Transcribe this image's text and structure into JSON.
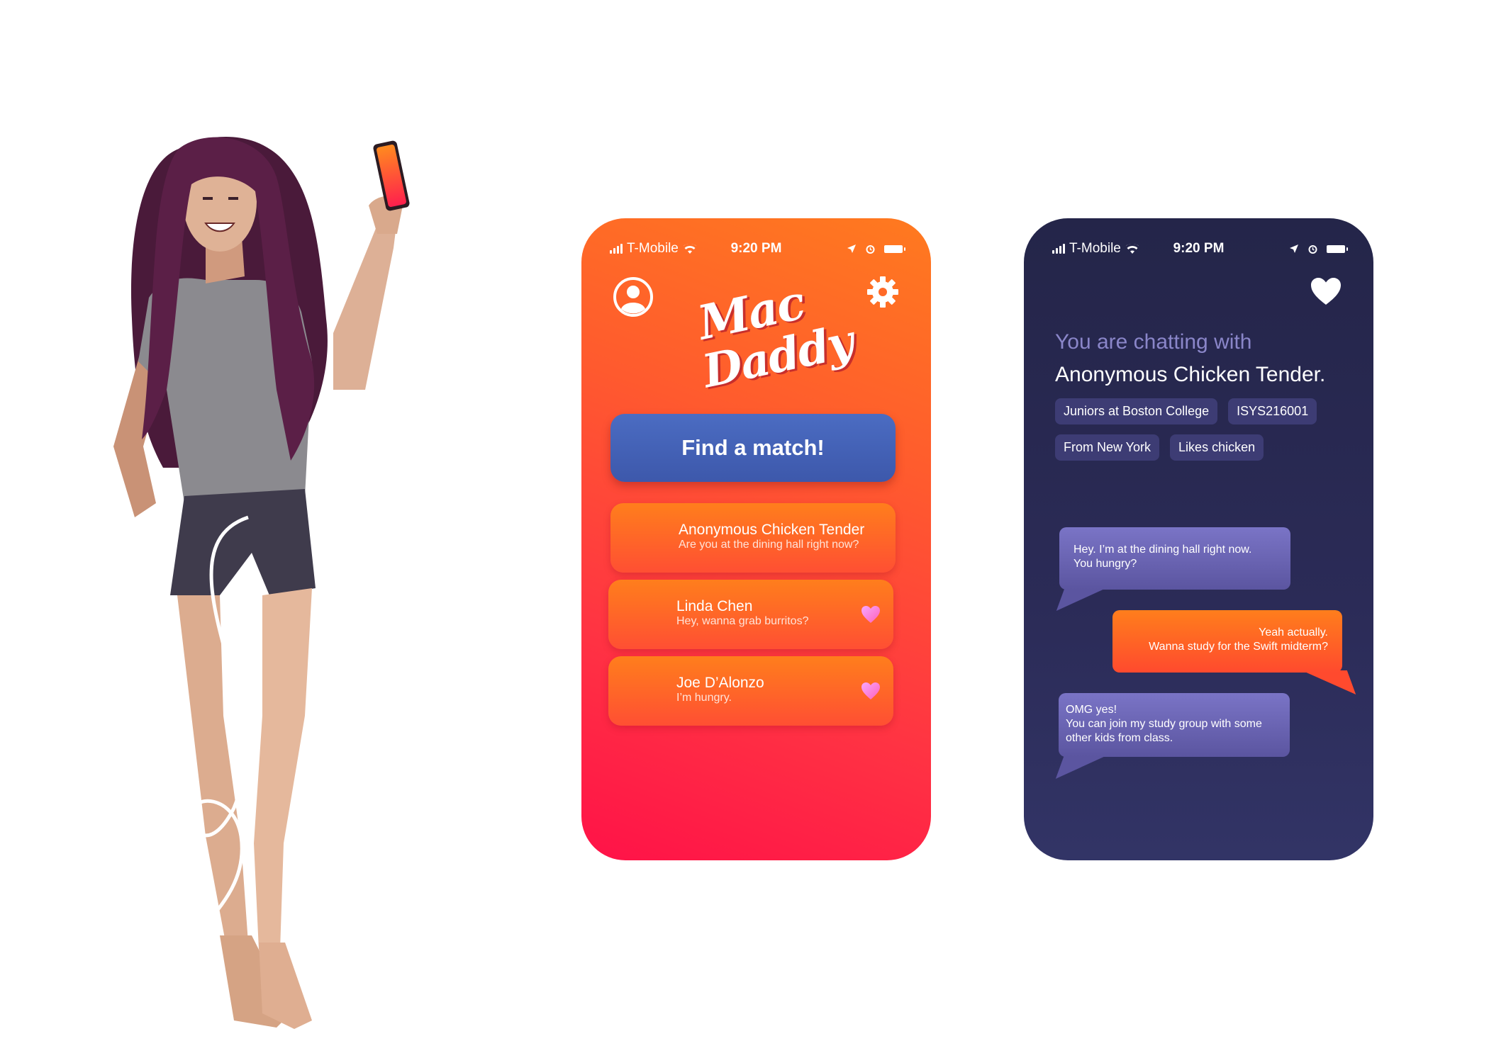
{
  "status_bar": {
    "carrier": "T-Mobile",
    "time": "9:20 PM"
  },
  "home_screen": {
    "logo_line1": "Mac",
    "logo_line2": "Daddy",
    "find_match_label": "Find a match!",
    "conversations": [
      {
        "name": "Anonymous Chicken Tender",
        "preview": "Are you at the dining hall right now?",
        "favorited": false
      },
      {
        "name": "Linda Chen",
        "preview": "Hey, wanna grab burritos?",
        "favorited": true
      },
      {
        "name": "Joe D’Alonzo",
        "preview": "I’m hungry.",
        "favorited": true
      }
    ]
  },
  "chat_screen": {
    "intro": "You are chatting with",
    "partner_name": "Anonymous Chicken Tender.",
    "tags": [
      "Juniors at Boston College",
      "ISYS216001",
      "From New York",
      "Likes chicken"
    ],
    "messages": [
      {
        "from": "them",
        "lines": [
          "Hey. I’m at the dining hall right now.",
          "You hungry?"
        ]
      },
      {
        "from": "me",
        "lines": [
          "Yeah actually.",
          "Wanna study for the Swift midterm?"
        ]
      },
      {
        "from": "them",
        "lines": [
          "OMG yes!",
          "You can join my study group with some",
          "other kids from class."
        ]
      }
    ]
  },
  "colors": {
    "home_gradient_top": "#ff7a1f",
    "home_gradient_bottom": "#ff1248",
    "chat_background": "#2b2b57",
    "find_button": "#4564b8",
    "heart_pink": "#f07ce0",
    "tag_background": "#3d3c74",
    "intro_text": "#8a86c9"
  }
}
